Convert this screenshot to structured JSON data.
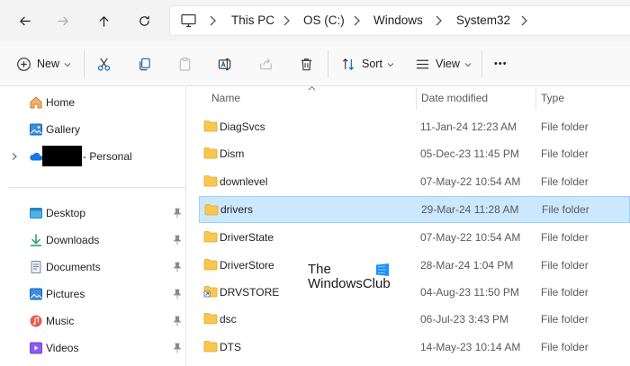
{
  "nav": {
    "back_icon": "arrow-left-icon",
    "forward_icon": "arrow-right-icon",
    "up_icon": "arrow-up-icon",
    "refresh_icon": "refresh-icon"
  },
  "address": {
    "crumbs": [
      "This PC",
      "OS (C:)",
      "Windows",
      "System32"
    ]
  },
  "toolbar": {
    "new_label": "New",
    "sort_label": "Sort",
    "view_label": "View",
    "more_label": "•••"
  },
  "sidebar": {
    "items": [
      {
        "label": "Home",
        "icon": "home-icon"
      },
      {
        "label": "Gallery",
        "icon": "gallery-icon"
      },
      {
        "label": "- Personal",
        "icon": "onedrive-cloud-icon"
      },
      {
        "label": "Desktop",
        "icon": "desktop-icon",
        "pinned": true
      },
      {
        "label": "Downloads",
        "icon": "download-icon",
        "pinned": true
      },
      {
        "label": "Documents",
        "icon": "documents-icon",
        "pinned": true
      },
      {
        "label": "Pictures",
        "icon": "pictures-icon",
        "pinned": true
      },
      {
        "label": "Music",
        "icon": "music-icon",
        "pinned": true
      },
      {
        "label": "Videos",
        "icon": "videos-icon",
        "pinned": true
      }
    ]
  },
  "columns": {
    "name": "Name",
    "date": "Date modified",
    "type": "Type"
  },
  "files": [
    {
      "name": "DiagSvcs",
      "date": "11-Jan-24 12:23 AM",
      "type": "File folder"
    },
    {
      "name": "Dism",
      "date": "05-Dec-23 11:45 PM",
      "type": "File folder"
    },
    {
      "name": "downlevel",
      "date": "07-May-22 10:54 AM",
      "type": "File folder"
    },
    {
      "name": "drivers",
      "date": "29-Mar-24 11:28 AM",
      "type": "File folder",
      "selected": true
    },
    {
      "name": "DriverState",
      "date": "07-May-22 10:54 AM",
      "type": "File folder"
    },
    {
      "name": "DriverStore",
      "date": "28-Mar-24 1:04 PM",
      "type": "File folder"
    },
    {
      "name": "DRVSTORE",
      "date": "04-Aug-23 11:50 PM",
      "type": "File folder"
    },
    {
      "name": "dsc",
      "date": "06-Jul-23 3:43 PM",
      "type": "File folder"
    },
    {
      "name": "DTS",
      "date": "14-May-23 10:14 AM",
      "type": "File folder"
    }
  ],
  "watermark": {
    "line1": "The",
    "line2": "WindowsClub"
  },
  "colors": {
    "selection_bg": "#cce8ff",
    "selection_border": "#99d1ff",
    "folder_yellow": "#f8c74f",
    "accent_blue": "#0067c0"
  }
}
